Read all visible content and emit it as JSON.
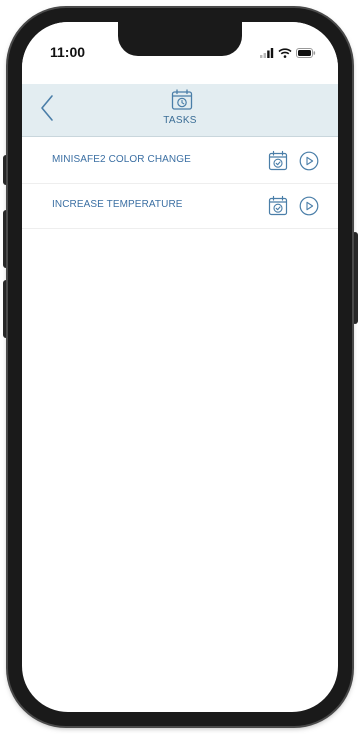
{
  "status_bar": {
    "time": "11:00",
    "signal_icon": "cellular-signal-icon",
    "wifi_icon": "wifi-icon",
    "battery_icon": "battery-icon"
  },
  "header": {
    "back_icon": "chevron-left-icon",
    "title_icon": "calendar-clock-icon",
    "title": "TASKS"
  },
  "tasks": [
    {
      "label": "MINISAFE2 COLOR CHANGE",
      "schedule_icon": "calendar-check-icon",
      "run_icon": "play-circle-icon"
    },
    {
      "label": "INCREASE TEMPERATURE",
      "schedule_icon": "calendar-check-icon",
      "run_icon": "play-circle-icon"
    }
  ],
  "colors": {
    "header_background": "#e3edf1",
    "accent": "#3b6fa3",
    "icon": "#4a7ea8"
  }
}
